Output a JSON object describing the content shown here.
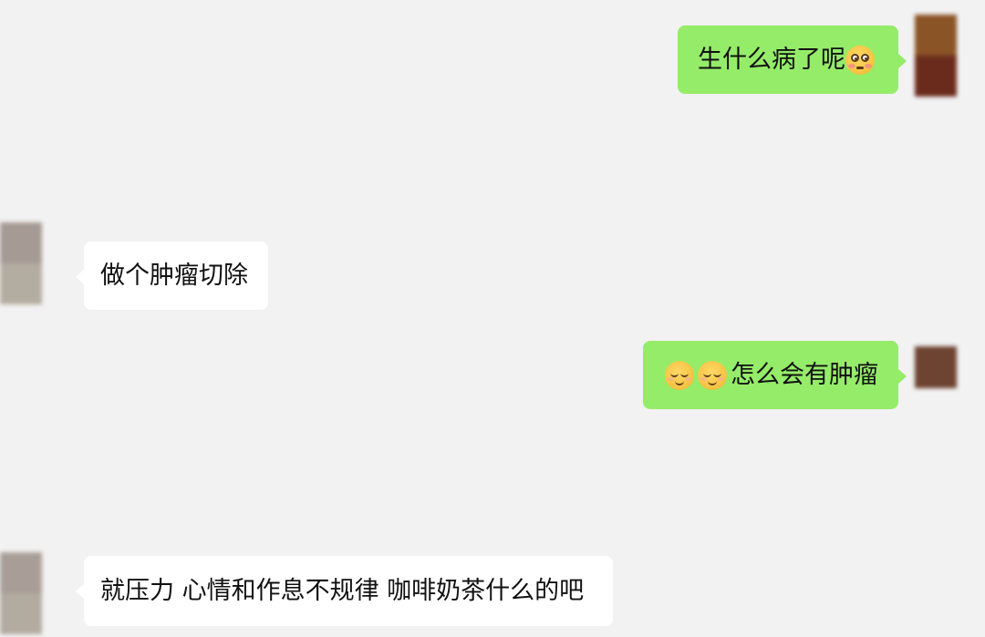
{
  "conversation": {
    "messages": [
      {
        "sender": "me",
        "text": "生什么病了呢",
        "emoji": [
          "flushed-face"
        ]
      },
      {
        "sender": "other",
        "text": "做个肿瘤切除"
      },
      {
        "sender": "me",
        "text": "怎么会有肿瘤",
        "emoji": [
          "relieved-face",
          "relieved-face"
        ]
      },
      {
        "sender": "other",
        "text": "就压力 心情和作息不规律 咖啡奶茶什么的吧"
      }
    ]
  },
  "colors": {
    "background": "#f2f2f2",
    "outgoing_bubble": "#95ec69",
    "incoming_bubble": "#ffffff",
    "text": "#111111"
  }
}
